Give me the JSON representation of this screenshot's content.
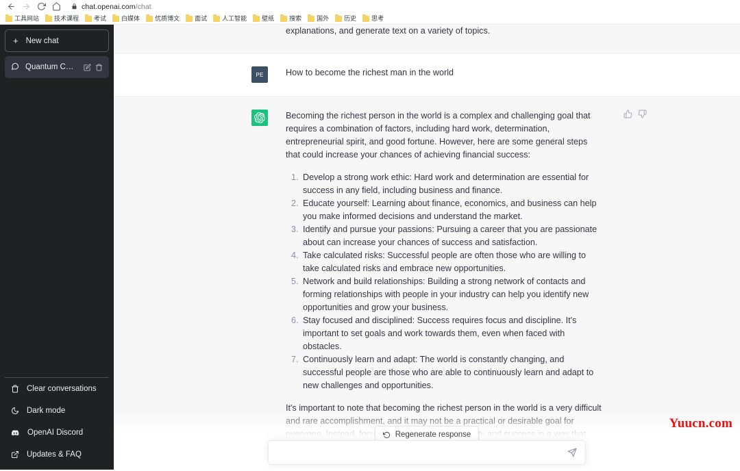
{
  "browser": {
    "url_host": "chat.openai.com",
    "url_path": "/chat",
    "back_icon": "back-arrow-icon",
    "forward_icon": "forward-arrow-icon",
    "reload_icon": "reload-icon",
    "home_icon": "home-icon",
    "lock_icon": "lock-icon",
    "bookmarks": [
      {
        "label": "工具网站"
      },
      {
        "label": "技术课程"
      },
      {
        "label": "考试"
      },
      {
        "label": "白媒体"
      },
      {
        "label": "优质博文"
      },
      {
        "label": "面试"
      },
      {
        "label": "人工智能"
      },
      {
        "label": "壁纸"
      },
      {
        "label": "搜索"
      },
      {
        "label": "国外"
      },
      {
        "label": "历史"
      },
      {
        "label": "思考"
      }
    ]
  },
  "sidebar": {
    "new_chat_label": "New chat",
    "new_chat_icon": "plus-icon",
    "conversations": [
      {
        "title": "Quantum Computing",
        "icon": "chat-bubble-icon",
        "edit_icon": "pencil-icon",
        "delete_icon": "trash-icon"
      }
    ],
    "footer": [
      {
        "label": "Clear conversations",
        "icon": "trash-icon"
      },
      {
        "label": "Dark mode",
        "icon": "moon-icon"
      },
      {
        "label": "OpenAI Discord",
        "icon": "discord-icon"
      },
      {
        "label": "Updates & FAQ",
        "icon": "external-link-icon"
      }
    ]
  },
  "chat": {
    "messages": [
      {
        "role": "assistant",
        "partial": true,
        "paragraphs": [
          "explanations, and generate text on a variety of topics."
        ]
      },
      {
        "role": "user",
        "avatar_initials": "PE",
        "paragraphs": [
          "How to become the richest man in the world"
        ]
      },
      {
        "role": "assistant",
        "avatar_icon": "openai-logo-icon",
        "intro": "Becoming the richest person in the world is a complex and challenging goal that requires a combination of factors, including hard work, determination, entrepreneurial spirit, and good fortune. However, here are some general steps that could increase your chances of achieving financial success:",
        "list": [
          "Develop a strong work ethic: Hard work and determination are essential for success in any field, including business and finance.",
          "Educate yourself: Learning about finance, economics, and business can help you make informed decisions and understand the market.",
          "Identify and pursue your passions: Pursuing a career that you are passionate about can increase your chances of success and satisfaction.",
          "Take calculated risks: Successful people are often those who are willing to take calculated risks and embrace new opportunities.",
          "Network and build relationships: Building a strong network of contacts and forming relationships with people in your industry can help you identify new opportunities and grow your business.",
          "Stay focused and disciplined: Success requires focus and discipline. It's important to set goals and work towards them, even when faced with obstacles.",
          "Continuously learn and adapt: The world is constantly changing, and successful people are those who are able to continuously learn and adapt to new challenges and opportunities."
        ],
        "outro": "It's important to note that becoming the richest person in the world is a very difficult and rare accomplishment, and it may not be a practical or desirable goal for everyone. Instead, focus on finding financial stability and success in a way that aligns with your values and passions.",
        "thumbs_up_icon": "thumbs-up-icon",
        "thumbs_down_icon": "thumbs-down-icon"
      }
    ]
  },
  "composer": {
    "regenerate_label": "Regenerate response",
    "regenerate_icon": "refresh-icon",
    "input_value": "",
    "input_placeholder": "",
    "send_icon": "send-icon"
  },
  "watermark": {
    "text": "Yuucn.com"
  },
  "colors": {
    "sidebar_bg": "#202123",
    "assistant_row_bg": "#f7f7f8",
    "bot_avatar": "#19c37d",
    "user_avatar": "#3b5066",
    "watermark": "#ee1111"
  }
}
